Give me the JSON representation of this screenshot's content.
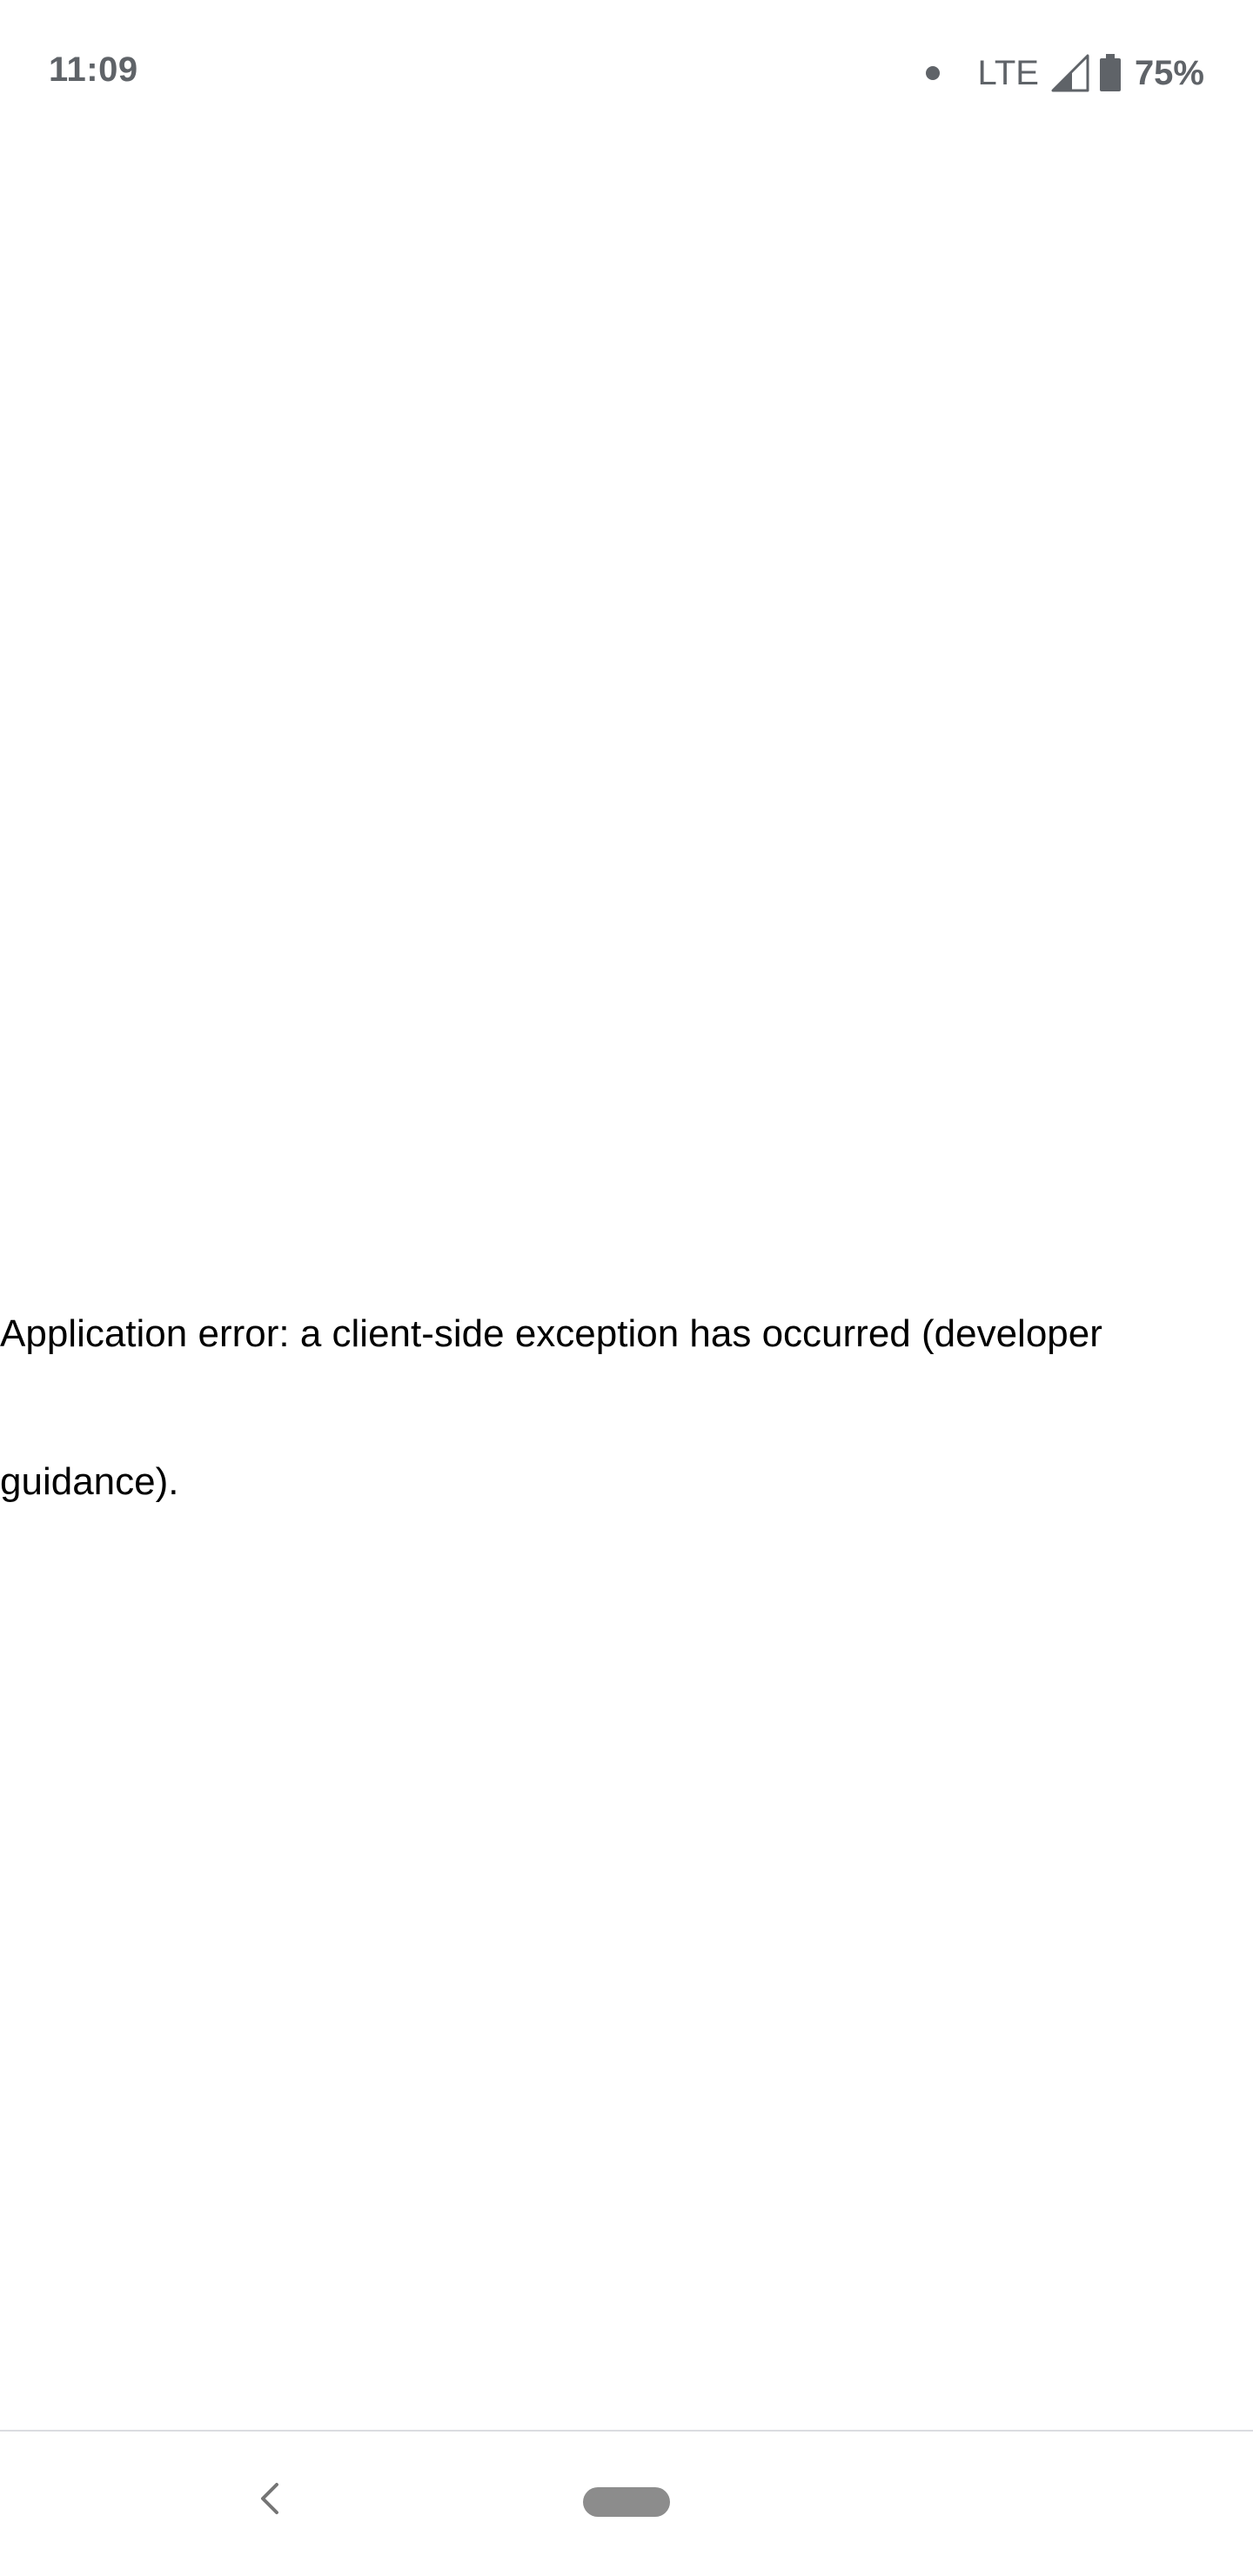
{
  "status_bar": {
    "time": "11:09",
    "network": "LTE",
    "battery": "75%",
    "icons": [
      "notification-dot-icon",
      "signal-icon",
      "battery-icon"
    ]
  },
  "main": {
    "error_text": "Application error: a client-side exception has occurred (developer guidance)."
  },
  "nav_bar": {
    "icons": [
      "back-icon",
      "home-pill-icon"
    ]
  },
  "colors": {
    "status_text": "#5f6368",
    "body_text": "#000000",
    "background": "#ffffff",
    "home_pill": "#8c8c8c"
  }
}
